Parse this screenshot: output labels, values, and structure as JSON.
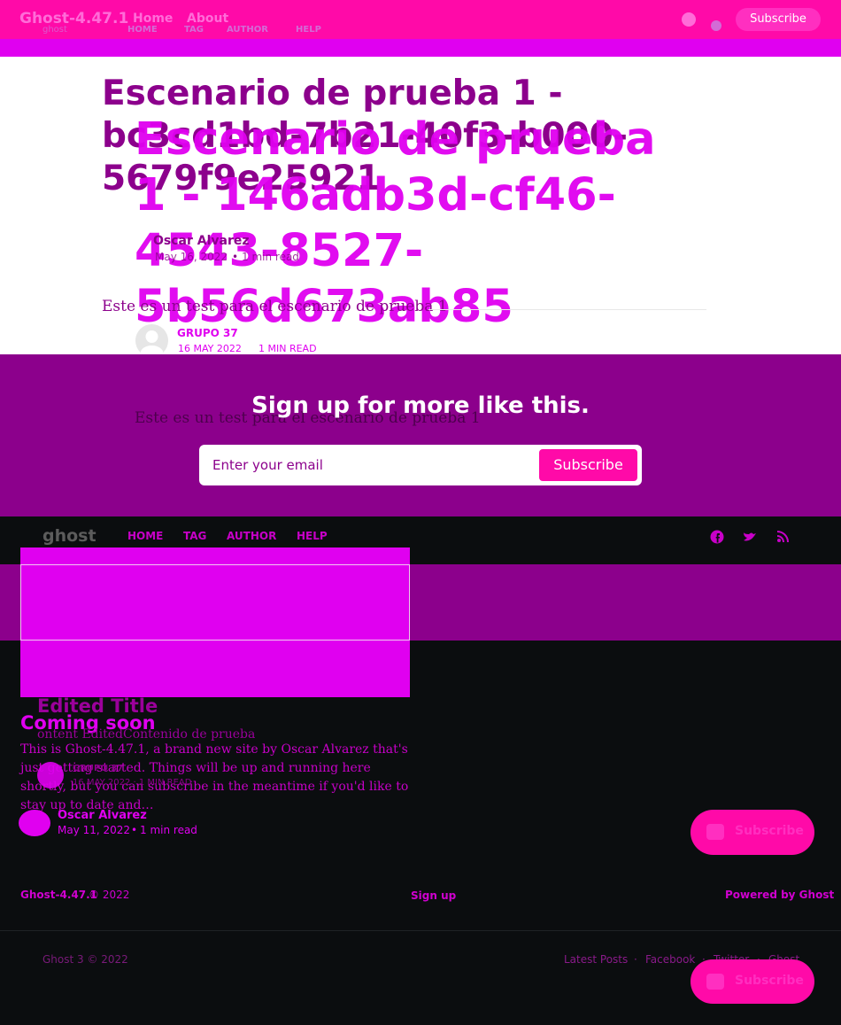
{
  "top_nav": {
    "site_title": "Ghost-4.47.1",
    "links": [
      "Home",
      "About"
    ],
    "ghost_nav": [
      "HOME",
      "TAG",
      "AUTHOR",
      "HELP"
    ],
    "subscribe_label": "Subscribe"
  },
  "post": {
    "title": "Escenario de prueba 1 - bc3cd1bd-7b21-40f3-b000-5679f9e25921",
    "overlay_title": "Escenario de prueba 1 - 146adb3d-cf46-4543-8527-5b56d673ab85",
    "author": "Oscar Alvarez",
    "date": "May 16, 2022",
    "reading_time": "1 min read",
    "excerpt": "Este es un test para el escenario de prueba 1",
    "author_upper": "GRUPO 37",
    "date_upper": "16 MAY 2022",
    "reading_time_upper": "1 MIN READ",
    "excerpt_2": "Este es un test para el escenario de prueba 1"
  },
  "signup": {
    "heading": "Sign up for more like this.",
    "placeholder": "Enter your email",
    "button": "Subscribe"
  },
  "footer_nav": {
    "logo": "ghost",
    "links": [
      "HOME",
      "TAG",
      "AUTHOR",
      "HELP"
    ]
  },
  "cards": {
    "edited_title": "Edited Title",
    "edited_excerpt": "ontent EditedContenido de prueba",
    "coming_title": "Coming soon",
    "coming_excerpt": "This is Ghost-4.47.1, a brand new site by Oscar Alvarez that's just getting started. Things will be up and running here shortly, but you can subscribe in the meantime if you'd like to stay up to date and…",
    "card_author_upper": "GRUPO 37",
    "card_meta_upper": "16 MAY 2022 · 1 MIN READ",
    "author": "Oscar Alvarez",
    "date": "May 11, 2022",
    "reading_time": "1 min read"
  },
  "floating": {
    "subscribe_1": "Subscribe",
    "subscribe_2": "Subscribe"
  },
  "footer": {
    "site": "Ghost-4.47.1",
    "copyright": "© 2022",
    "sign_up": "Sign up",
    "powered": "Powered by Ghost",
    "ghost3": "Ghost 3 © 2022",
    "links": [
      "Latest Posts",
      "Facebook",
      "Twitter",
      "Ghost"
    ]
  },
  "colors": {
    "pink": "#ff0aa8",
    "magenta": "#e000f0",
    "purple": "#8c008c",
    "dark": "#0b0d0f"
  }
}
